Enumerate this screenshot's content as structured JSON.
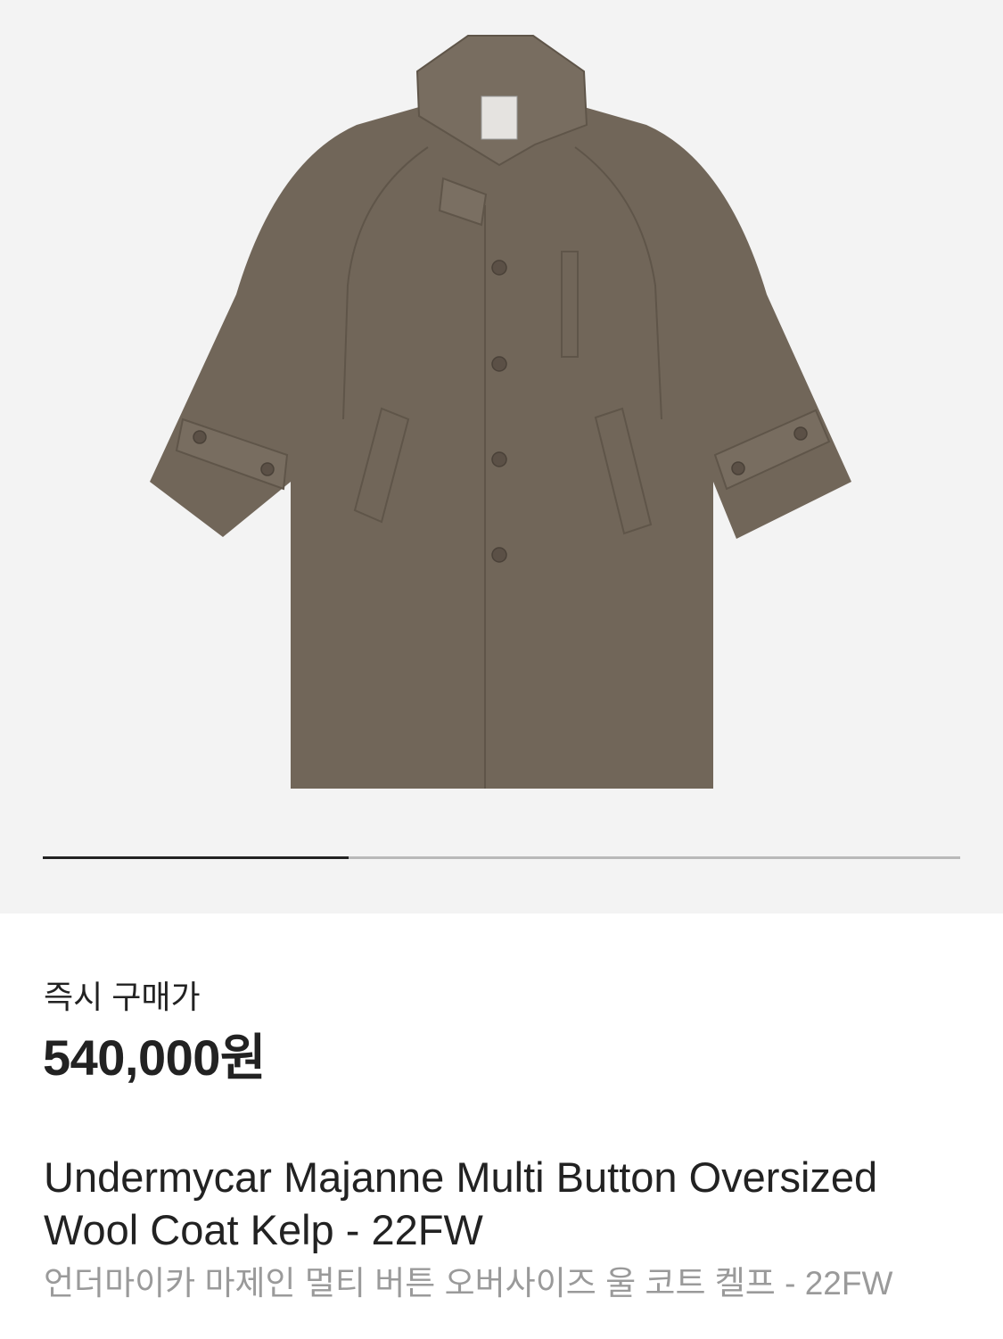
{
  "gallery": {
    "image_alt": "wool-coat-photo",
    "background_color": "#f3f3f3",
    "coat_color": "#716659",
    "progress_fraction": 0.333
  },
  "product": {
    "price_label": "즉시 구매가",
    "price": "540,000원",
    "title_en_line1": "Undermycar Majanne Multi Button Oversized",
    "title_en_line2": "Wool Coat Kelp - 22FW",
    "title_ko": "언더마이카 마제인 멀티 버튼 오버사이즈 울 코트 켈프 - 22FW"
  }
}
